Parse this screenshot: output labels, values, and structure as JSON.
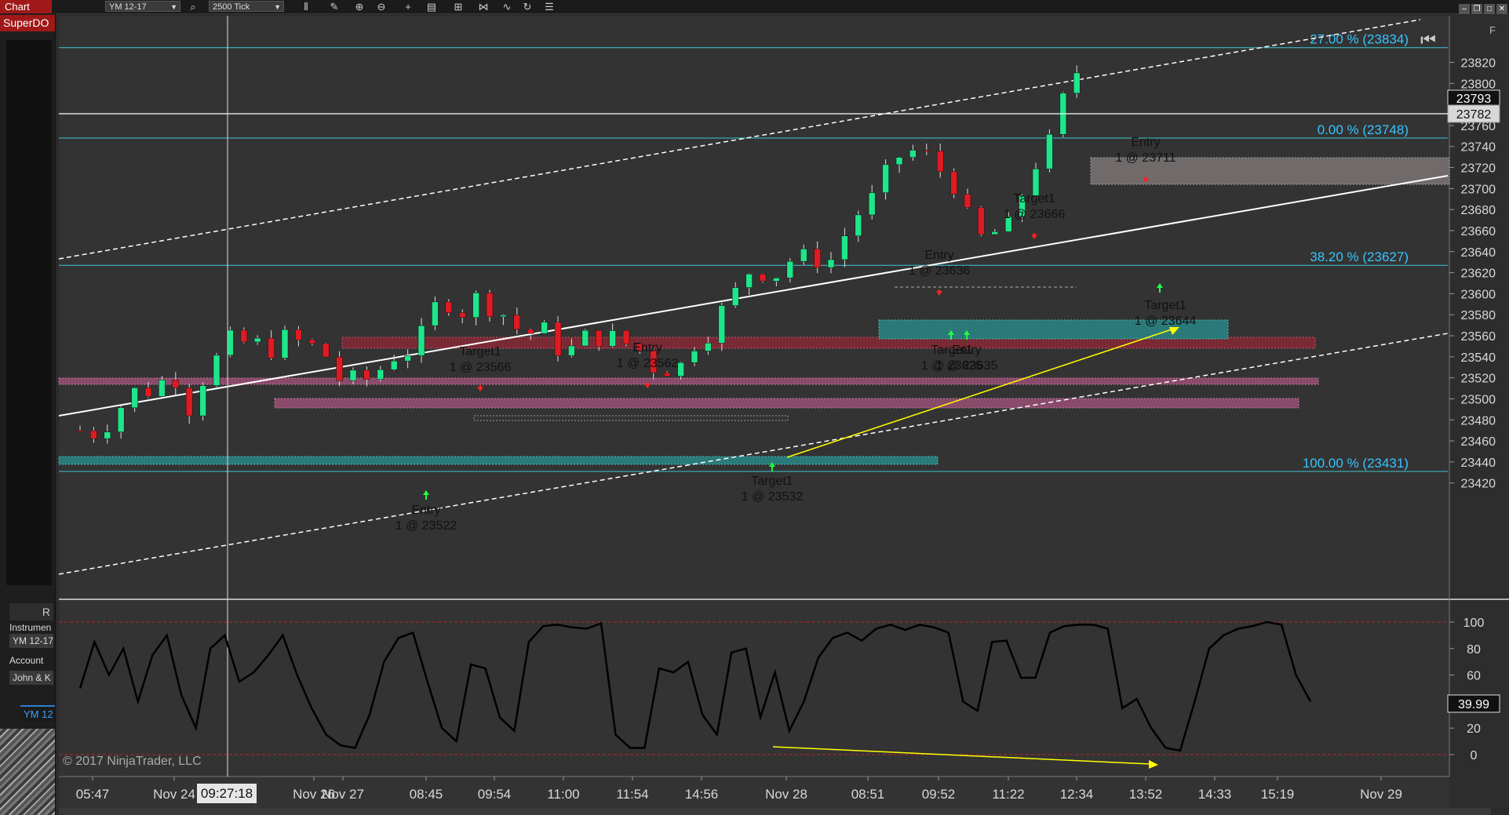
{
  "toolbar": {
    "tab_label": "Chart",
    "instrument": "YM 12-17",
    "bar_type": "2500 Tick",
    "icons": [
      "search-icon",
      "bar-style-icon",
      "pencil-icon",
      "zoom-in-icon",
      "zoom-out-icon",
      "crosshair-icon",
      "chart-properties-icon",
      "data-box-icon",
      "strategies-icon",
      "indicators-icon",
      "refresh-icon",
      "list-icon"
    ],
    "window_controls": [
      "minimize-icon",
      "restore-icon",
      "maximize-icon",
      "close-icon"
    ]
  },
  "left_panel": {
    "superdom_label": "SuperDO",
    "r_button": "R",
    "instrument_label": "Instrumen",
    "instrument_value": "YM 12-17",
    "account_label": "Account",
    "account_value": "John & K",
    "tab_label": "YM 12"
  },
  "price_panel": {
    "fib_levels": [
      {
        "price": 23834,
        "label": "27.00 % (23834)"
      },
      {
        "price": 23748,
        "label": "0.00 % (23748)"
      },
      {
        "price": 23627,
        "label": "38.20 % (23627)"
      },
      {
        "price": 23431,
        "label": "100.00 % (23431)"
      }
    ],
    "current_price": "23793",
    "crosshair_price": "23782",
    "y_ticks": [
      "23820",
      "23800",
      "23780",
      "23760",
      "23740",
      "23720",
      "23700",
      "23680",
      "23660",
      "23640",
      "23620",
      "23600",
      "23580",
      "23560",
      "23540",
      "23520",
      "23500",
      "23480",
      "23460",
      "23440",
      "23420"
    ],
    "order_labels": [
      {
        "line1": "Target1",
        "line2": "1 @ 23566"
      },
      {
        "line1": "Entry",
        "line2": "1 @ 23562"
      },
      {
        "line1": "Entry",
        "line2": "1 @ 23522"
      },
      {
        "line1": "Target1",
        "line2": "1 @ 23532"
      },
      {
        "line1": "Entry",
        "line2": "1 @ 23636"
      },
      {
        "line1": "Target1",
        "line2": "1 @ 23666"
      },
      {
        "line1": "Target1",
        "line2": "1 @ 23625"
      },
      {
        "line1": "Entry",
        "line2": "1 @ 23635"
      },
      {
        "line1": "Entry",
        "line2": "1 @ 23711"
      },
      {
        "line1": "Target1",
        "line2": "1 @ 23644"
      }
    ],
    "panel_corner": "F"
  },
  "oscillator_panel": {
    "current_value": "39.99",
    "y_ticks": [
      "100",
      "80",
      "60",
      "40",
      "20",
      "0"
    ]
  },
  "x_axis": {
    "labels": [
      "05:47",
      "Nov 24",
      "Nov 26",
      "Nov 27",
      "08:45",
      "09:54",
      "11:00",
      "11:54",
      "14:56",
      "Nov 28",
      "08:51",
      "09:52",
      "11:22",
      "12:34",
      "13:52",
      "14:33",
      "15:19",
      "Nov 29"
    ],
    "crosshair_time": "09:27:18"
  },
  "copyright": "© 2017 NinjaTrader, LLC",
  "colors": {
    "up_candle": "#1ee68a",
    "down_candle": "#e01a22",
    "fib_line": "#3fc6d6",
    "fib_text": "#39c4ff",
    "teal_zone": "#2a7a7a",
    "red_zone": "#7a2a34",
    "pink_zone": "#8a4a6a",
    "trend_line": "#ffffff",
    "arrow": "#ffff00"
  }
}
